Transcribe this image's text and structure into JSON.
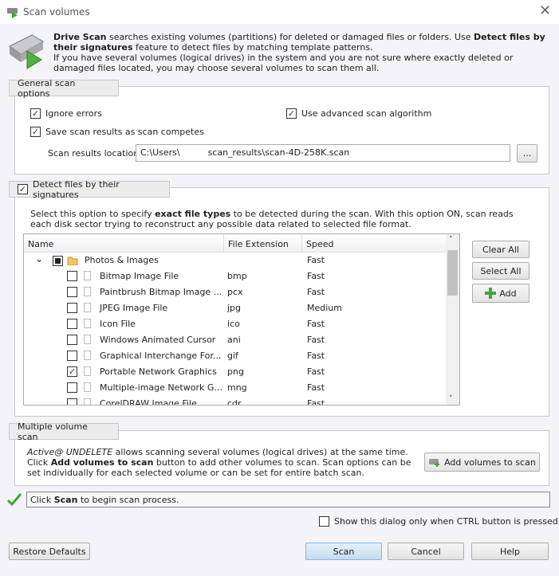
{
  "window": {
    "title": "Scan volumes",
    "close_icon": "close-icon"
  },
  "header": {
    "p1_bold": "Drive Scan",
    "p1_text": " searches existing volumes (partitions) for deleted or damaged files or folders. Use ",
    "p1_bold2": "Detect files by their signatures",
    "p1_text2": " feature to detect files by matching template patterns.",
    "p2": "If you have several volumes (logical drives) in the system and you are not sure where exactly deleted or damaged files located, you may choose several volumes to scan them all."
  },
  "general": {
    "tab": "General scan options",
    "ignore_errors": "Ignore errors",
    "advanced": "Use advanced scan algorithm",
    "save_results": "Save scan results as scan competes",
    "location_label": "Scan results location:",
    "location_value": "C:\\Users\\          scan_results\\scan-4D-258K.scan",
    "browse": "..."
  },
  "detect": {
    "tab": "Detect files by their signatures",
    "desc_1": "Select this option to specify ",
    "desc_bold": "exact file types",
    "desc_2": " to be detected during the scan. With this option ON, scan reads each disk sector trying to reconstruct any possible data related to selected file format.",
    "columns": [
      "Name",
      "File Extension",
      "Speed"
    ],
    "group": {
      "name": "Photos & Images",
      "speed": "Fast"
    },
    "rows": [
      {
        "name": "Bitmap Image File",
        "ext": "bmp",
        "speed": "Fast",
        "checked": false
      },
      {
        "name": "Paintbrush Bitmap Image ...",
        "ext": "pcx",
        "speed": "Fast",
        "checked": false
      },
      {
        "name": "JPEG Image File",
        "ext": "jpg",
        "speed": "Medium",
        "checked": false
      },
      {
        "name": "Icon File",
        "ext": "ico",
        "speed": "Fast",
        "checked": false
      },
      {
        "name": "Windows Animated Cursor",
        "ext": "ani",
        "speed": "Fast",
        "checked": false
      },
      {
        "name": "Graphical Interchange For...",
        "ext": "gif",
        "speed": "Fast",
        "checked": false
      },
      {
        "name": "Portable Network Graphics",
        "ext": "png",
        "speed": "Fast",
        "checked": true
      },
      {
        "name": "Multiple-image Network G...",
        "ext": "mng",
        "speed": "Fast",
        "checked": false
      },
      {
        "name": "CorelDRAW Image File",
        "ext": "cdr",
        "speed": "Fast",
        "checked": false
      }
    ],
    "clear_all": "Clear All",
    "select_all": "Select All",
    "add": "Add"
  },
  "multi": {
    "tab": "Multiple volume scan",
    "t1_italic": "Active@ UNDELETE",
    "t1": " allows scanning several volumes (logical drives) at the same time. Click ",
    "t1_bold": "Add volumes to scan",
    "t2": " button to add other volumes to scan. Scan options can be set individually for each selected volume or can be set for entire batch scan.",
    "button": "Add volumes to scan"
  },
  "status": {
    "pre": "Click ",
    "bold": "Scan",
    "post": " to begin scan process."
  },
  "ctrl_option": "Show this dialog only when CTRL button is pressed",
  "buttons": {
    "restore": "Restore Defaults",
    "scan": "Scan",
    "cancel": "Cancel",
    "help": "Help"
  },
  "colors": {
    "accent_green": "#3fa535",
    "scan_button": "#cfe3f3"
  }
}
